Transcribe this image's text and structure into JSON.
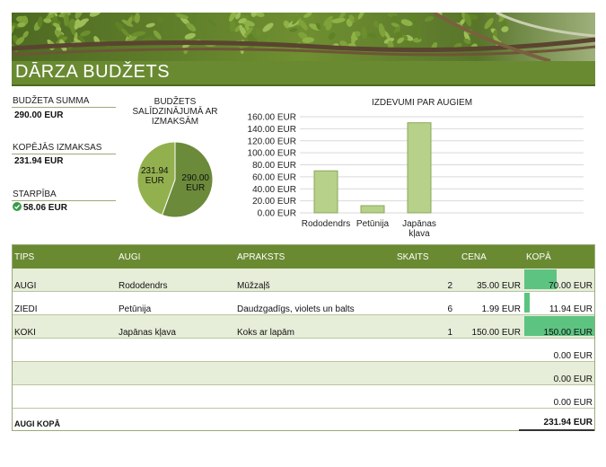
{
  "header": {
    "title": "DĀRZA BUDŽETS"
  },
  "summary": {
    "budget_label": "BUDŽETA SUMMA",
    "budget_value": "290.00 EUR",
    "costs_label": "KOPĒJĀS IZMAKSAS",
    "costs_value": "231.94 EUR",
    "diff_label": "STARPĪBA",
    "diff_value": "58.06 EUR",
    "diff_icon": "check-circle-icon"
  },
  "colors": {
    "accent": "#6a8a32",
    "band": "#e6edd8",
    "bar_fill": "#5dc381",
    "pie_budget": "#6b8a3a",
    "pie_costs": "#93b04e"
  },
  "chart_data": [
    {
      "type": "pie",
      "title": "BUDŽETS SALĪDZINĀJUMĀ AR IZMAKSĀM",
      "slices": [
        {
          "label": "231.94 EUR",
          "value": 231.94
        },
        {
          "label": "290.00 EUR",
          "value": 290.0
        }
      ]
    },
    {
      "type": "bar",
      "title": "IZDEVUMI PAR AUGIEM",
      "categories": [
        "Rododendrs",
        "Petūnija",
        "Japānas kļava"
      ],
      "values": [
        70,
        11.94,
        150
      ],
      "ylim": [
        0,
        160
      ],
      "yticks": [
        "0.00 EUR",
        "20.00 EUR",
        "40.00 EUR",
        "60.00 EUR",
        "80.00 EUR",
        "100.00 EUR",
        "120.00 EUR",
        "140.00 EUR",
        "160.00 EUR"
      ],
      "grid": true
    }
  ],
  "table": {
    "headers": {
      "type": "TIPS",
      "plant": "AUGI",
      "desc": "APRAKSTS",
      "qty": "SKAITS",
      "price": "CENA",
      "total": "KOPĀ"
    },
    "rows": [
      {
        "type": "AUGI",
        "plant": "Rododendrs",
        "desc": "Mūžzaļš",
        "qty": "2",
        "price": "35.00 EUR",
        "total": "70.00 EUR",
        "share": 0.467
      },
      {
        "type": "ZIEDI",
        "plant": "Petūnija",
        "desc": "Daudzgadīgs, violets un balts",
        "qty": "6",
        "price": "1.99 EUR",
        "total": "11.94 EUR",
        "share": 0.08
      },
      {
        "type": "KOKI",
        "plant": "Japānas kļava",
        "desc": "Koks ar lapām",
        "qty": "1",
        "price": "150.00 EUR",
        "total": "150.00 EUR",
        "share": 1.0
      },
      {
        "type": "",
        "plant": "",
        "desc": "",
        "qty": "",
        "price": "",
        "total": "0.00 EUR",
        "share": 0
      },
      {
        "type": "",
        "plant": "",
        "desc": "",
        "qty": "",
        "price": "",
        "total": "0.00 EUR",
        "share": 0
      },
      {
        "type": "",
        "plant": "",
        "desc": "",
        "qty": "",
        "price": "",
        "total": "0.00 EUR",
        "share": 0
      }
    ],
    "footer_label": "AUGI KOPĀ",
    "footer_value": "231.94 EUR"
  }
}
